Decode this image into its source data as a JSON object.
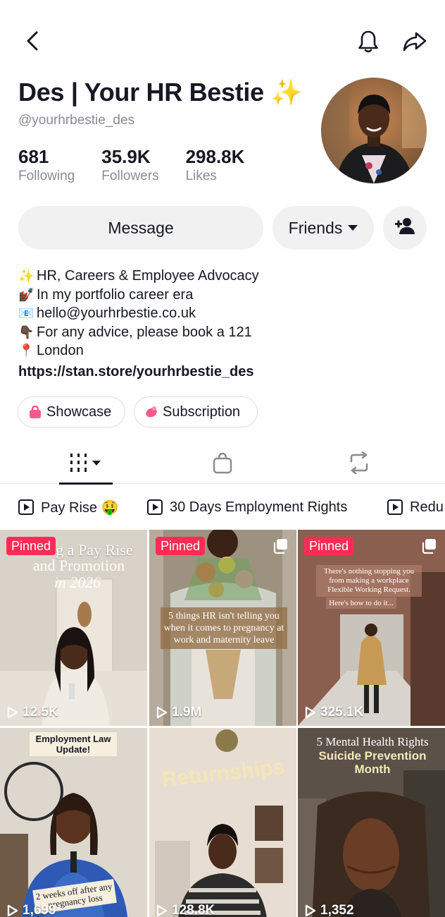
{
  "profile": {
    "name": "Des | Your HR Bestie ✨",
    "handle": "@yourhrbestie_des",
    "stats": [
      {
        "value": "681",
        "label": "Following"
      },
      {
        "value": "35.9K",
        "label": "Followers"
      },
      {
        "value": "298.8K",
        "label": "Likes"
      }
    ]
  },
  "actions": {
    "message": "Message",
    "friends": "Friends"
  },
  "bio": {
    "lines": [
      {
        "icon": "✨",
        "text": "HR, Careers & Employee Advocacy"
      },
      {
        "icon": "💅🏿",
        "text": "In my portfolio career era"
      },
      {
        "icon": "📧",
        "text": "hello@yourhrbestie.co.uk"
      },
      {
        "icon": "👇🏿",
        "text": "For any advice, please book a 121"
      },
      {
        "icon": "📍",
        "text": "London"
      }
    ],
    "link": "https://stan.store/yourhrbestie_des"
  },
  "chips": {
    "showcase": "Showcase",
    "subscription": "Subscription"
  },
  "playlists": [
    "Pay Rise 🤑",
    "30 Days Employment Rights",
    "Redu"
  ],
  "videos": [
    {
      "pinned": "Pinned",
      "views": "12.5K",
      "overlay": [
        "g a Pay Rise",
        "and Promotion",
        "in 2026"
      ]
    },
    {
      "pinned": "Pinned",
      "views": "1.9M",
      "overlay": [
        "5 things HR isn't telling you when it comes to pregnancy at work and maternity leave"
      ]
    },
    {
      "pinned": "Pinned",
      "views": "325.1K",
      "overlay": [
        "There's nothing stopping you from making a workplace Flexible Working Request.",
        "Here's how to do it..."
      ]
    },
    {
      "views": "1,699",
      "overlay": [
        "Employment Law Update!",
        "2 weeks off after any pregnancy loss"
      ]
    },
    {
      "views": "128.8K",
      "overlay": [
        "Returnships"
      ]
    },
    {
      "views": "1,352",
      "overlay": [
        "5 Mental Health Rights",
        "Suicide Prevention Month"
      ]
    }
  ],
  "colors": {
    "accent": "#fe2c55",
    "pill_bg": "#f1f1f2",
    "muted_text": "#8a8b91"
  }
}
